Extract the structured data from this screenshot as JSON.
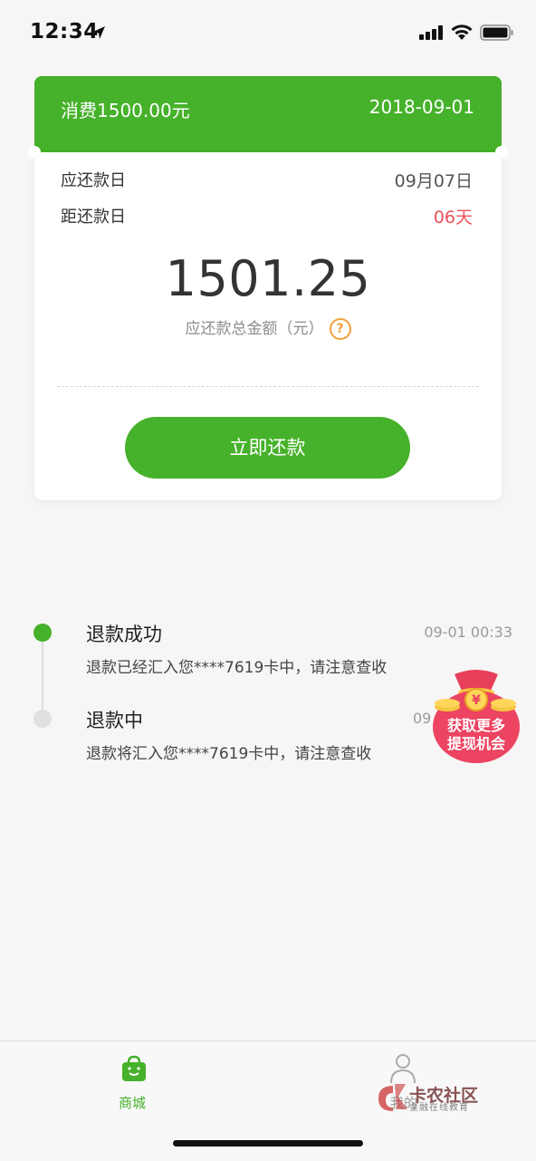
{
  "status_bar": {
    "time": "12:34"
  },
  "bill": {
    "amount_title": "消费1500.00元",
    "date": "2018-09-01",
    "due_label": "应还款日",
    "due_value": "09月07日",
    "days_label": "距还款日",
    "days_value": "06天",
    "total_amount": "1501.25",
    "total_label": "应还款总金额（元）",
    "help_symbol": "?",
    "repay_button": "立即还款"
  },
  "timeline": [
    {
      "title": "退款成功",
      "time": "09-01 00:33",
      "desc": "退款已经汇入您****7619卡中，请注意查收"
    },
    {
      "title": "退款中",
      "time": "09",
      "desc": "退款将汇入您****7619卡中，请注意查收"
    }
  ],
  "promo": {
    "line1": "获取更多",
    "line2": "提现机会",
    "symbol": "¥"
  },
  "tabbar": {
    "mall": "商城",
    "me": "我的"
  },
  "watermark": {
    "title": "卡农社区",
    "subtitle": "金融在线教育"
  },
  "colors": {
    "brand_green": "#46b12a",
    "days_red": "#e8515c",
    "help_orange": "#f2a03a"
  }
}
